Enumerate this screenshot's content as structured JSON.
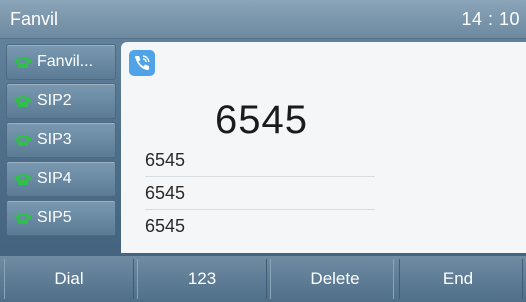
{
  "header": {
    "brand": "Fanvil",
    "time": "14 : 10"
  },
  "sidebar": {
    "items": [
      {
        "label": "Fanvil...",
        "icon": "phone-handset-icon"
      },
      {
        "label": "SIP2",
        "icon": "phone-handset-icon"
      },
      {
        "label": "SIP3",
        "icon": "phone-handset-icon"
      },
      {
        "label": "SIP4",
        "icon": "phone-handset-icon"
      },
      {
        "label": "SIP5",
        "icon": "phone-handset-icon"
      }
    ]
  },
  "main": {
    "call_icon": "calling-phone-icon",
    "dialed_number": "6545",
    "history": [
      "6545",
      "6545",
      "6545"
    ]
  },
  "softkeys": {
    "dial": "Dial",
    "mode": "123",
    "delete": "Delete",
    "end": "End"
  },
  "colors": {
    "line_icon": "#2fbf4a",
    "call_icon_bg": "#4fa3e6"
  }
}
